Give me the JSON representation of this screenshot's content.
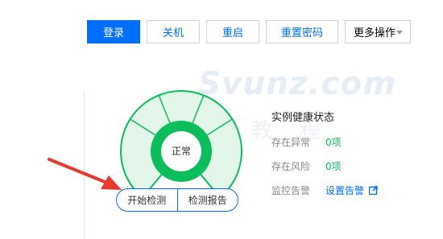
{
  "toolbar": {
    "login": "登录",
    "shutdown": "关机",
    "restart": "重启",
    "reset_password": "重置密码",
    "more_actions": "更多操作"
  },
  "watermark": {
    "text": "Svunz.com",
    "sub": "云教程"
  },
  "gauge": {
    "status": "正常",
    "accent": "#0abf5b",
    "fill": "#e3f6ea"
  },
  "health": {
    "title": "实例健康状态",
    "rows": [
      {
        "label": "存在异常",
        "value": "0项"
      },
      {
        "label": "存在风险",
        "value": "0项"
      },
      {
        "label": "监控告警",
        "link": "设置告警"
      }
    ]
  },
  "actions": {
    "start_check": "开始检测",
    "check_report": "检测报告"
  },
  "colors": {
    "primary": "#006eff",
    "arrow": "#e8382f"
  }
}
